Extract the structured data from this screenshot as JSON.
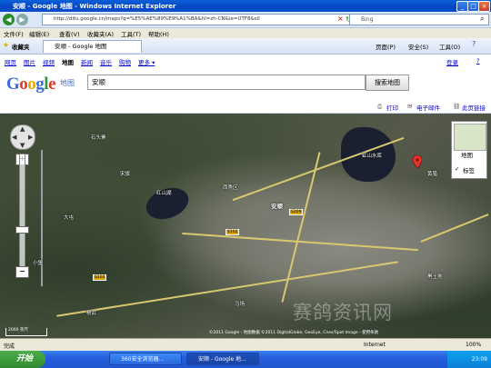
{
  "window": {
    "title": "安顺 - Google 地图 - Windows Internet Explorer",
    "min": "_",
    "max": "□",
    "close": "×"
  },
  "address": {
    "url": "http://ditu.google.cn/maps?q=%E5%AE%89%E9%A1%BA&hl=zh-CN&ie=UTF8&sll",
    "search_placeholder": "Bing"
  },
  "menu": [
    "文件(F)",
    "编辑(E)",
    "查看(V)",
    "收藏夹(A)",
    "工具(T)",
    "帮助(H)"
  ],
  "favorites": {
    "label": "收藏夹",
    "tab": "安顺 - Google 地图",
    "page": "页面(P)",
    "safety": "安全(S)",
    "tools": "工具(O)"
  },
  "gbar": {
    "links": [
      "网页",
      "图片",
      "视频",
      "地图",
      "新闻",
      "音乐",
      "购物",
      "更多 ▾"
    ],
    "right": [
      "登录",
      "?"
    ]
  },
  "search": {
    "logo": "Google",
    "logo_sub": "地图",
    "value": "安顺",
    "button": "搜索地图"
  },
  "strip": {
    "print": "打印",
    "email": "电子邮件",
    "link": "此页链接"
  },
  "map": {
    "maptype": {
      "map": "地图",
      "satellite": "卫星",
      "label": "标签"
    },
    "labels": [
      "安顺",
      "贵州",
      "安顺市",
      "西秀区",
      "红山湖",
      "虹山水库",
      "石头寨",
      "宋旗",
      "大屯",
      "黄腊",
      "杨武",
      "黑土地",
      "小堡",
      "马场"
    ],
    "roads": [
      "S102",
      "S209",
      "S102"
    ],
    "watermark": "赛鸽资讯网",
    "copyright": "©2011 Google - 地图数据 ©2011 DigitalGlobe, GeoEye, Cnes/Spot Image - 使用条款",
    "scale": "2000 英尺"
  },
  "status": {
    "left": "完成",
    "zone": "Internet",
    "zoom": "100%"
  },
  "taskbar": {
    "start": "开始",
    "tasks": [
      "360安全浏览器...",
      "安顺 - Google 地..."
    ],
    "clock": "23:09"
  }
}
